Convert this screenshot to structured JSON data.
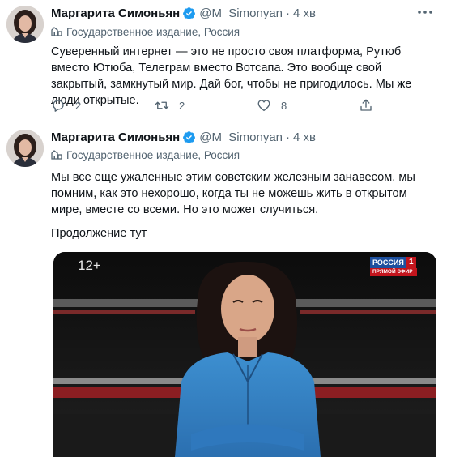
{
  "tweets": [
    {
      "author_name": "Маргарита Симоньян",
      "handle": "@M_Simonyan",
      "separator": "·",
      "time": "4 хв",
      "label": "Государственное издание, Россия",
      "text": "Суверенный интернет — это не просто своя платформа, Рутюб вместо Ютюба, Телеграм вместо Вотсапа. Это вообще свой закрытый, замкнутый мир. Дай бог, чтобы не пригодилось. Мы же люди открытые.",
      "replies": "2",
      "retweets": "2",
      "likes": "8"
    },
    {
      "author_name": "Маргарита Симоньян",
      "handle": "@M_Simonyan",
      "separator": "·",
      "time": "4 хв",
      "label": "Государственное издание, Россия",
      "text": "Мы все еще ужаленные этим советским железным занавесом, мы помним, как это нехорошо, когда ты не можешь жить в открытом мире, вместе со всеми. Но это может случиться.",
      "continuation": "Продолжение тут",
      "media": {
        "age_rating": "12+",
        "channel_name": "РОССИЯ",
        "channel_number": "1",
        "channel_sub": "ПРЯМОЙ ЭФИР"
      }
    }
  ],
  "colors": {
    "text_primary": "#0f1419",
    "text_secondary": "#536471",
    "verified": "#1d9bf0",
    "divider": "#eff3f4"
  },
  "icons": [
    "verified-badge-icon",
    "more-options-icon",
    "government-building-icon",
    "reply-icon",
    "retweet-icon",
    "like-icon",
    "share-icon"
  ]
}
